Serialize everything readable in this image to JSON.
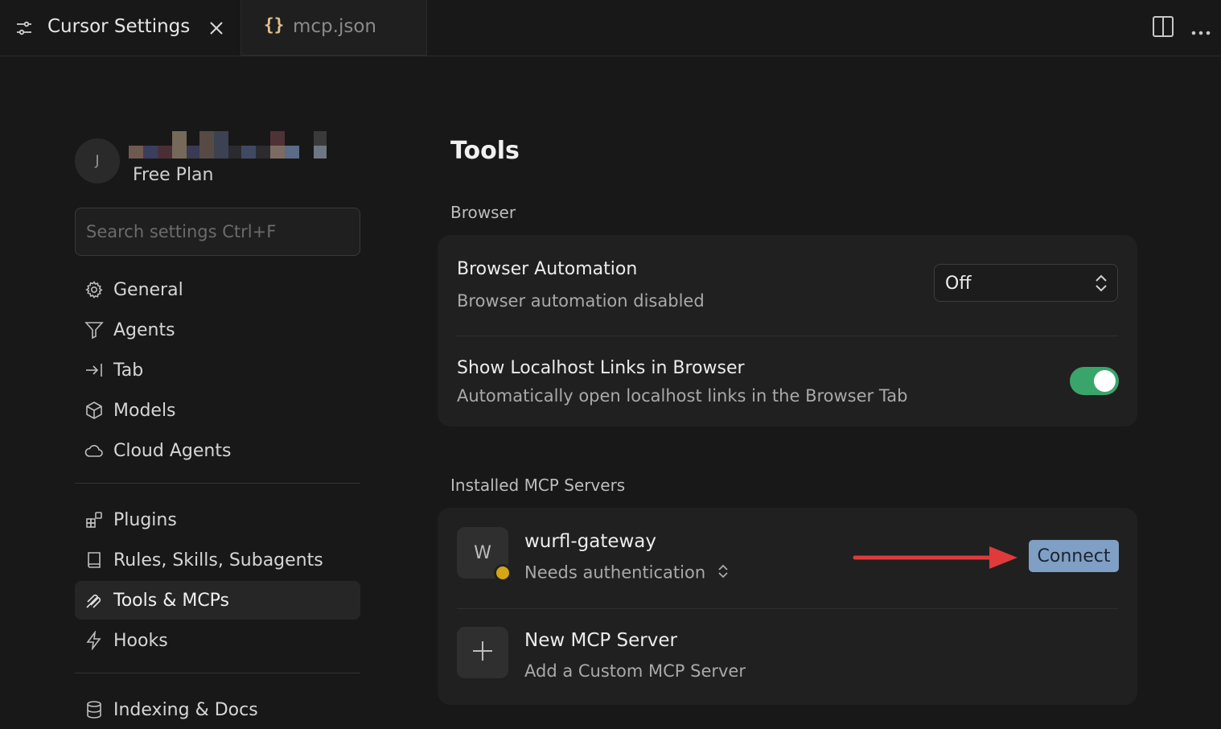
{
  "tabs": [
    {
      "label": "Cursor Settings",
      "icon": "settings-sliders-icon",
      "active": true
    },
    {
      "label": "mcp.json",
      "icon": "json-braces-icon",
      "active": false
    }
  ],
  "account": {
    "avatar_initial": "J",
    "plan": "Free Plan"
  },
  "search": {
    "placeholder": "Search settings Ctrl+F"
  },
  "sidebar": {
    "items": [
      {
        "label": "General",
        "icon": "gear-icon"
      },
      {
        "label": "Agents",
        "icon": "agents-icon"
      },
      {
        "label": "Tab",
        "icon": "tab-arrow-icon"
      },
      {
        "label": "Models",
        "icon": "cube-icon"
      },
      {
        "label": "Cloud Agents",
        "icon": "cloud-icon"
      },
      {
        "label": "Plugins",
        "icon": "plugins-icon"
      },
      {
        "label": "Rules, Skills, Subagents",
        "icon": "book-icon"
      },
      {
        "label": "Tools & MCPs",
        "icon": "tools-icon",
        "active": true
      },
      {
        "label": "Hooks",
        "icon": "lightning-icon"
      },
      {
        "label": "Indexing & Docs",
        "icon": "database-icon"
      }
    ]
  },
  "main": {
    "title": "Tools",
    "browser": {
      "section": "Browser",
      "automation": {
        "title": "Browser Automation",
        "subtitle": "Browser automation disabled",
        "value": "Off"
      },
      "localhost": {
        "title": "Show Localhost Links in Browser",
        "subtitle": "Automatically open localhost links in the Browser Tab",
        "enabled": true
      }
    },
    "mcp": {
      "section": "Installed MCP Servers",
      "server": {
        "initial": "W",
        "name": "wurfl-gateway",
        "status": "Needs authentication",
        "status_color": "#d4a514",
        "action": "Connect"
      },
      "new_server": {
        "title": "New MCP Server",
        "subtitle": "Add a Custom MCP Server"
      }
    }
  },
  "colors": {
    "accent_button": "#7f9fc4",
    "toggle_on": "#3aa56a",
    "arrow": "#e03a3a"
  }
}
